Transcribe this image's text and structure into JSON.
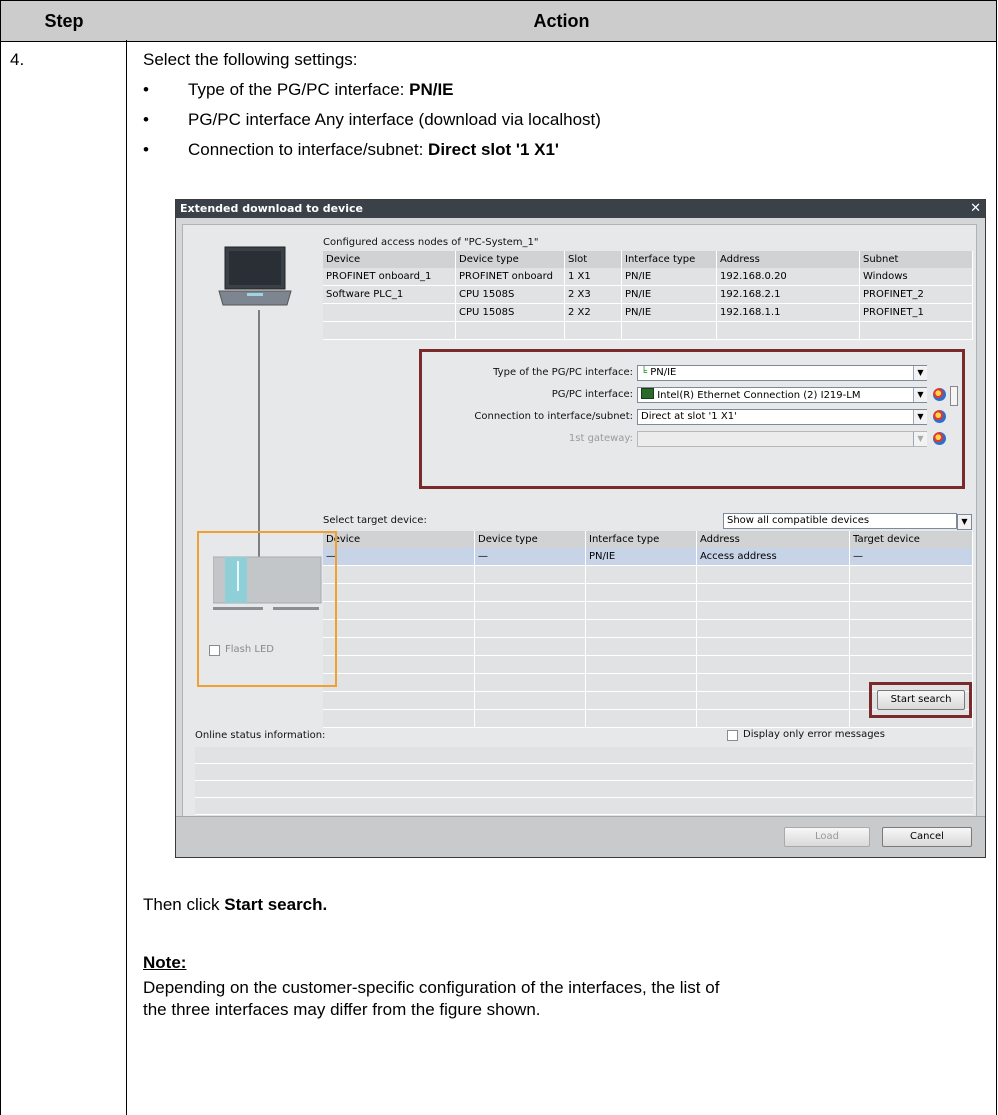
{
  "table": {
    "header_step": "Step",
    "header_action": "Action",
    "step_number": "4."
  },
  "content": {
    "intro": "Select the following settings:",
    "bullet1_prefix": "Type of the PG/PC interface: ",
    "bullet1_value": "PN/IE",
    "bullet2": "PG/PC interface Any interface (download via localhost)",
    "bullet3_prefix": "Connection to interface/subnet: ",
    "bullet3_value": "Direct slot '1 X1'",
    "then_prefix": "Then click ",
    "then_value": "Start search.",
    "note_heading": "Note:",
    "note_line1": "Depending on the customer-specific configuration of the interfaces, the list of",
    "note_line2": "the three interfaces may differ from the figure shown."
  },
  "dialog": {
    "title": "Extended download to device",
    "close_glyph": "✕",
    "configured_label": "Configured access nodes of \"PC-System_1\"",
    "access_headers": [
      "Device",
      "Device type",
      "Slot",
      "Interface type",
      "Address",
      "Subnet"
    ],
    "access_rows": [
      [
        "PROFINET onboard_1",
        "PROFINET onboard",
        "1 X1",
        "PN/IE",
        "192.168.0.20",
        "Windows"
      ],
      [
        "Software PLC_1",
        "CPU 1508S",
        "2 X3",
        "PN/IE",
        "192.168.2.1",
        "PROFINET_2"
      ],
      [
        "",
        "CPU 1508S",
        "2 X2",
        "PN/IE",
        "192.168.1.1",
        "PROFINET_1"
      ]
    ],
    "type_label": "Type of the PG/PC interface:",
    "type_value": "PN/IE",
    "pgpc_label": "PG/PC interface:",
    "pgpc_value": "Intel(R) Ethernet Connection (2) I219-LM",
    "conn_label": "Connection to interface/subnet:",
    "conn_value": "Direct at slot '1 X1'",
    "gateway_label": "1st gateway:",
    "gateway_value": "",
    "select_target_label": "Select target device:",
    "show_filter_value": "Show all compatible devices",
    "target_headers": [
      "Device",
      "Device type",
      "Interface type",
      "Address",
      "Target device"
    ],
    "target_rows": [
      [
        "—",
        "—",
        "PN/IE",
        "Access address",
        "—"
      ]
    ],
    "flash_led_label": "Flash LED",
    "start_search_label": "Start search",
    "online_status_label": "Online status information:",
    "display_errors_label": "Display only error messages",
    "load_label": "Load",
    "cancel_label": "Cancel"
  },
  "colors": {
    "highlight_red": "#7a2a2a",
    "highlight_orange": "#f0a030",
    "selected_row": "#c7d3e6"
  }
}
